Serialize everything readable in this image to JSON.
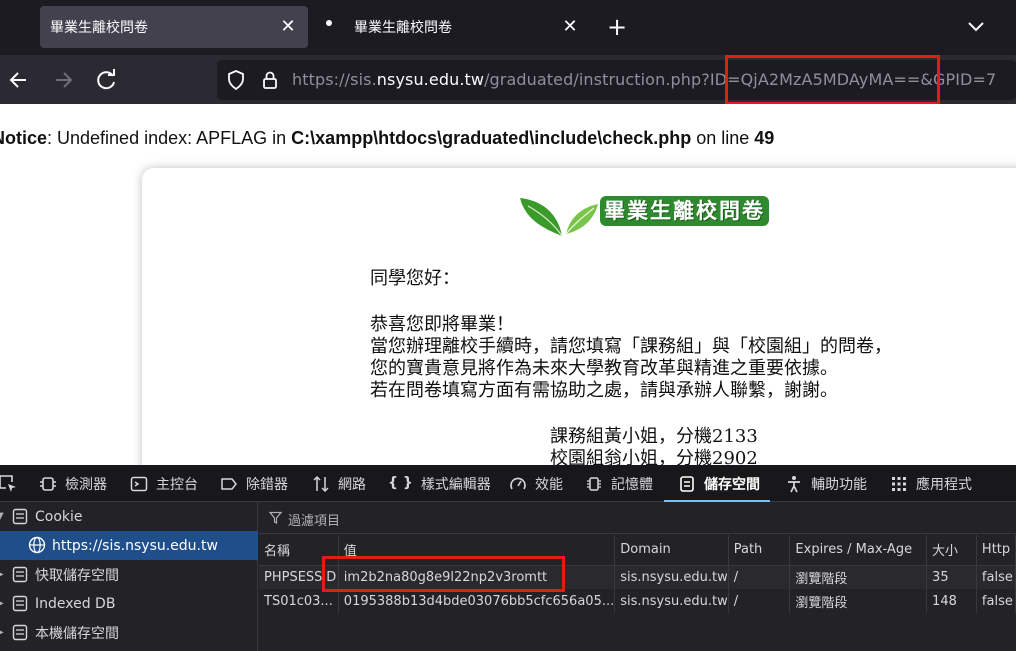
{
  "tabs": [
    {
      "title": "畢業生離校問卷",
      "close": "✕"
    },
    {
      "title": "畢業生離校問卷",
      "close": "✕"
    }
  ],
  "new_tab": "+",
  "url": {
    "scheme": "https://sis.",
    "host": "nsysu.edu.tw",
    "path": "/graduated/instruction.php?ID=QjA2MzA5MDAyMA==&GPID=7"
  },
  "notice": {
    "label": "Notice",
    "message": ": Undefined index: APFLAG in ",
    "file": "C:\\xampp\\htdocs\\graduated\\include\\check.php",
    "on_line": " on line ",
    "line": "49"
  },
  "logo_title": "畢業生離校問卷",
  "letter": {
    "greeting": "同學您好：",
    "line1": "恭喜您即將畢業！",
    "line2": "當您辦理離校手續時，請您填寫「課務組」與「校園組」的問卷，",
    "line3": "您的寶貴意見將作為未來大學教育改革與精進之重要依據。",
    "line4": "若在問卷填寫方面有需協助之處，請與承辦人聯繫，謝謝。",
    "contact1": "課務組黃小姐，分機2133",
    "contact2": "校園組翁小姐，分機2902"
  },
  "devtools": {
    "tabs": [
      "檢測器",
      "主控台",
      "除錯器",
      "網路",
      "樣式編輯器",
      "效能",
      "記憶體",
      "儲存空間",
      "輔助功能",
      "應用程式"
    ],
    "selected_tab": "儲存空間",
    "sidebar": {
      "cookie": "Cookie",
      "cookie_host": "https://sis.nsysu.edu.tw",
      "cache": "快取儲存空間",
      "indexeddb": "Indexed DB",
      "local": "本機儲存空間"
    },
    "filter_placeholder": "過濾項目",
    "columns": [
      "名稱",
      "值",
      "Domain",
      "Path",
      "Expires / Max-Age",
      "大小",
      "Http"
    ],
    "rows": [
      [
        "PHPSESSID",
        "im2b2na80g8e9l22np2v3romtt",
        "sis.nsysu.edu.tw",
        "/",
        "瀏覽階段",
        "35",
        "false"
      ],
      [
        "TS01c03...",
        "0195388b13d4bde03076bb5cfc656a05...",
        "sis.nsysu.edu.tw",
        "/",
        "瀏覽階段",
        "148",
        "false"
      ]
    ]
  },
  "colors": {
    "highlight_box": "#e41b1b",
    "accent": "#75bfff",
    "logo_green": "#2f8a2f"
  }
}
